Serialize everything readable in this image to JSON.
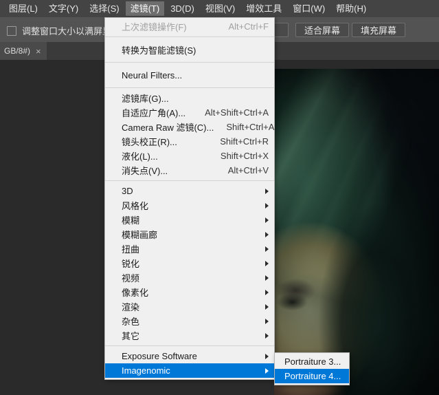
{
  "menubar": {
    "items": [
      {
        "label": "图层(L)",
        "active": false
      },
      {
        "label": "文字(Y)",
        "active": false
      },
      {
        "label": "选择(S)",
        "active": false
      },
      {
        "label": "滤镜(T)",
        "active": true
      },
      {
        "label": "3D(D)",
        "active": false
      },
      {
        "label": "视图(V)",
        "active": false
      },
      {
        "label": "增效工具",
        "active": false
      },
      {
        "label": "窗口(W)",
        "active": false
      },
      {
        "label": "帮助(H)",
        "active": false
      }
    ]
  },
  "options_bar": {
    "checkbox_label": "调整窗口大小以满屏显示",
    "checkbox_checked": false,
    "buttons": [
      {
        "label": ""
      },
      {
        "label": "适合屏幕"
      },
      {
        "label": "填充屏幕"
      }
    ]
  },
  "tabbar": {
    "document_tab": {
      "label": "GB/8#)",
      "close_glyph": "×"
    }
  },
  "filter_menu": {
    "groups": [
      [
        {
          "label": "上次滤镜操作(F)",
          "accel": "Alt+Ctrl+F",
          "disabled": true,
          "submenu": false,
          "selected": false
        }
      ],
      [
        {
          "label": "转换为智能滤镜(S)",
          "accel": "",
          "disabled": false,
          "submenu": false,
          "selected": false
        }
      ],
      [
        {
          "label": "Neural Filters...",
          "accel": "",
          "disabled": false,
          "submenu": false,
          "selected": false
        }
      ],
      [
        {
          "label": "滤镜库(G)...",
          "accel": "",
          "disabled": false,
          "submenu": false,
          "selected": false
        },
        {
          "label": "自适应广角(A)...",
          "accel": "Alt+Shift+Ctrl+A",
          "disabled": false,
          "submenu": false,
          "selected": false
        },
        {
          "label": "Camera Raw 滤镜(C)...",
          "accel": "Shift+Ctrl+A",
          "disabled": false,
          "submenu": false,
          "selected": false
        },
        {
          "label": "镜头校正(R)...",
          "accel": "Shift+Ctrl+R",
          "disabled": false,
          "submenu": false,
          "selected": false
        },
        {
          "label": "液化(L)...",
          "accel": "Shift+Ctrl+X",
          "disabled": false,
          "submenu": false,
          "selected": false
        },
        {
          "label": "消失点(V)...",
          "accel": "Alt+Ctrl+V",
          "disabled": false,
          "submenu": false,
          "selected": false
        }
      ],
      [
        {
          "label": "3D",
          "accel": "",
          "disabled": false,
          "submenu": true,
          "selected": false
        },
        {
          "label": "风格化",
          "accel": "",
          "disabled": false,
          "submenu": true,
          "selected": false
        },
        {
          "label": "模糊",
          "accel": "",
          "disabled": false,
          "submenu": true,
          "selected": false
        },
        {
          "label": "模糊画廊",
          "accel": "",
          "disabled": false,
          "submenu": true,
          "selected": false
        },
        {
          "label": "扭曲",
          "accel": "",
          "disabled": false,
          "submenu": true,
          "selected": false
        },
        {
          "label": "锐化",
          "accel": "",
          "disabled": false,
          "submenu": true,
          "selected": false
        },
        {
          "label": "视频",
          "accel": "",
          "disabled": false,
          "submenu": true,
          "selected": false
        },
        {
          "label": "像素化",
          "accel": "",
          "disabled": false,
          "submenu": true,
          "selected": false
        },
        {
          "label": "渲染",
          "accel": "",
          "disabled": false,
          "submenu": true,
          "selected": false
        },
        {
          "label": "杂色",
          "accel": "",
          "disabled": false,
          "submenu": true,
          "selected": false
        },
        {
          "label": "其它",
          "accel": "",
          "disabled": false,
          "submenu": true,
          "selected": false
        }
      ],
      [
        {
          "label": "Exposure Software",
          "accel": "",
          "disabled": false,
          "submenu": true,
          "selected": false
        },
        {
          "label": "Imagenomic",
          "accel": "",
          "disabled": false,
          "submenu": true,
          "selected": true
        }
      ]
    ]
  },
  "submenu": {
    "items": [
      {
        "label": "Portraiture 3...",
        "selected": false
      },
      {
        "label": "Portraiture 4...",
        "selected": true
      }
    ]
  },
  "colors": {
    "accent_highlight": "#0078d7",
    "menu_background": "#f0f0f0",
    "menubar_background": "#444444",
    "options_bar_background": "#535353",
    "canvas_background": "#2a2a2a"
  }
}
